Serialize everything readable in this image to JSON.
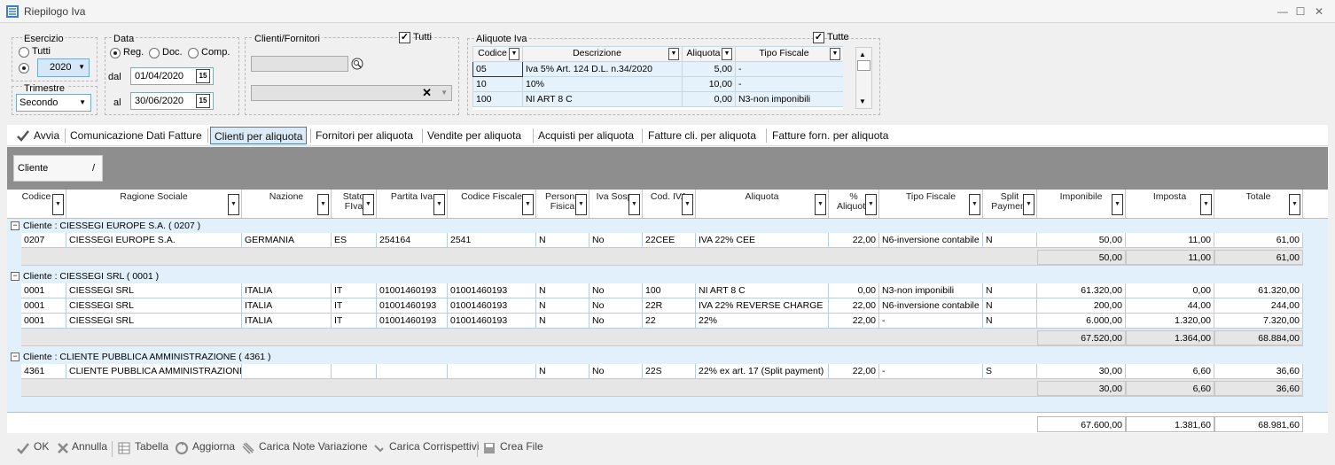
{
  "window": {
    "title": "Riepilogo Iva",
    "controls": [
      "—",
      "☐",
      "✕"
    ]
  },
  "filters": {
    "esercizio": {
      "label": "Esercizio",
      "opt_all": "Tutti",
      "selected": "2020"
    },
    "trimestre": {
      "label": "Trimestre",
      "value": "Secondo"
    },
    "data": {
      "label": "Data",
      "opts": [
        "Reg.",
        "Doc.",
        "Comp."
      ],
      "dal_label": "dal",
      "dal": "01/04/2020",
      "al_label": "al",
      "al": "30/06/2020",
      "cal": "15"
    },
    "clienti_fornitori": {
      "label": "Clienti/Fornitori",
      "tutti": "Tutti"
    },
    "aliquote": {
      "label": "Aliquote Iva",
      "tutte": "Tutte",
      "headers": [
        "Codice",
        "Descrizione",
        "Aliquota",
        "Tipo Fiscale"
      ],
      "rows": [
        [
          "05",
          "Iva 5% Art. 124 D.L. n.34/2020",
          "5,00",
          "-"
        ],
        [
          "10",
          "10%",
          "10,00",
          "-"
        ],
        [
          "100",
          "NI ART 8 C",
          "0,00",
          "N3-non imponibili"
        ]
      ]
    }
  },
  "toolbar": {
    "avvia": "Avvia",
    "tabs": [
      "Comunicazione Dati Fatture",
      "Clienti per aliquota",
      "Fornitori per aliquota",
      "Vendite per aliquota",
      "Acquisti per aliquota",
      "Fatture cli. per aliquota",
      "Fatture forn. per aliquota"
    ]
  },
  "group_chip": {
    "label": "Cliente",
    "sort": "/"
  },
  "grid": {
    "headers": [
      "Codice",
      "Ragione Sociale",
      "Nazione",
      "Stato\nFIva",
      "Partita Iva",
      "Codice Fiscale",
      "Persona\nFisica",
      "Iva Sosp.",
      "Cod. IVA",
      "Aliquota",
      "%\nAliquota",
      "Tipo Fiscale",
      "Split\nPayment",
      "Imponibile",
      "Imposta",
      "Totale"
    ],
    "groups": [
      {
        "title": "Cliente : CIESSEGI EUROPE S.A.  ( 0207 )",
        "rows": [
          [
            "0207",
            "CIESSEGI EUROPE S.A.",
            "GERMANIA",
            "ES",
            "254164",
            "2541",
            "N",
            "No",
            "22CEE",
            "IVA 22% CEE",
            "22,00",
            "N6-inversione contabile",
            "N",
            "50,00",
            "11,00",
            "61,00"
          ]
        ],
        "subtotal": [
          "50,00",
          "11,00",
          "61,00"
        ]
      },
      {
        "title": "Cliente : CIESSEGI SRL  ( 0001 )",
        "rows": [
          [
            "0001",
            "CIESSEGI SRL",
            "ITALIA",
            "IT",
            "01001460193",
            "01001460193",
            "N",
            "No",
            "100",
            "NI ART 8 C",
            "0,00",
            "N3-non imponibili",
            "N",
            "61.320,00",
            "0,00",
            "61.320,00"
          ],
          [
            "0001",
            "CIESSEGI SRL",
            "ITALIA",
            "IT",
            "01001460193",
            "01001460193",
            "N",
            "No",
            "22R",
            "IVA 22% REVERSE CHARGE",
            "22,00",
            "N6-inversione contabile",
            "N",
            "200,00",
            "44,00",
            "244,00"
          ],
          [
            "0001",
            "CIESSEGI SRL",
            "ITALIA",
            "IT",
            "01001460193",
            "01001460193",
            "N",
            "No",
            "22",
            "22%",
            "22,00",
            "-",
            "N",
            "6.000,00",
            "1.320,00",
            "7.320,00"
          ]
        ],
        "subtotal": [
          "67.520,00",
          "1.364,00",
          "68.884,00"
        ]
      },
      {
        "title": "Cliente : CLIENTE PUBBLICA AMMINISTRAZIONE  ( 4361 )",
        "rows": [
          [
            "4361",
            "CLIENTE PUBBLICA AMMINISTRAZIONE",
            "",
            "",
            "",
            "",
            "N",
            "No",
            "22S",
            "22% ex art. 17 (Split payment)",
            "22,00",
            "-",
            "S",
            "30,00",
            "6,60",
            "36,60"
          ]
        ],
        "subtotal": [
          "30,00",
          "6,60",
          "36,60"
        ]
      }
    ],
    "totals": [
      "67.600,00",
      "1.381,60",
      "68.981,60"
    ]
  },
  "bottom": {
    "ok": "OK",
    "annulla": "Annulla",
    "tabella": "Tabella",
    "aggiorna": "Aggiorna",
    "carica_note": "Carica Note Variazione",
    "carica_corr": "Carica Corrispettivi",
    "crea_file": "Crea File"
  }
}
